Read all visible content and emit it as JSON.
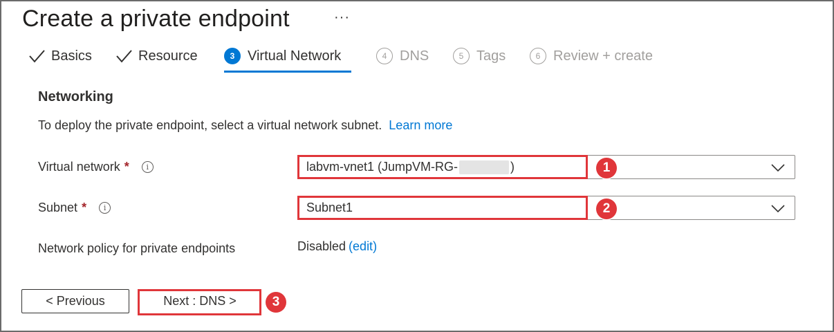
{
  "header": {
    "title": "Create a private endpoint",
    "more_label": "···"
  },
  "tabs": [
    {
      "label": "Basics",
      "state": "completed"
    },
    {
      "label": "Resource",
      "state": "completed"
    },
    {
      "number": "3",
      "label": "Virtual Network",
      "state": "active"
    },
    {
      "number": "4",
      "label": "DNS",
      "state": "disabled"
    },
    {
      "number": "5",
      "label": "Tags",
      "state": "disabled"
    },
    {
      "number": "6",
      "label": "Review + create",
      "state": "disabled"
    }
  ],
  "networking": {
    "heading": "Networking",
    "description": "To deploy the private endpoint, select a virtual network subnet.",
    "learn_more": "Learn more",
    "virtual_network": {
      "label": "Virtual network",
      "required": "*",
      "info": "i",
      "value_prefix": "labvm-vnet1 (JumpVM-RG-",
      "value_suffix": ")"
    },
    "subnet": {
      "label": "Subnet",
      "required": "*",
      "info": "i",
      "value": "Subnet1"
    },
    "policy": {
      "label": "Network policy for private endpoints",
      "value": "Disabled",
      "edit": "(edit)"
    }
  },
  "footer": {
    "previous": "< Previous",
    "next": "Next : DNS >"
  },
  "annotations": {
    "badges": [
      "1",
      "2",
      "3"
    ],
    "color": "#e0363a"
  },
  "colors": {
    "accent": "#0078d4",
    "required": "#a4262c",
    "disabled": "#a19f9d"
  }
}
